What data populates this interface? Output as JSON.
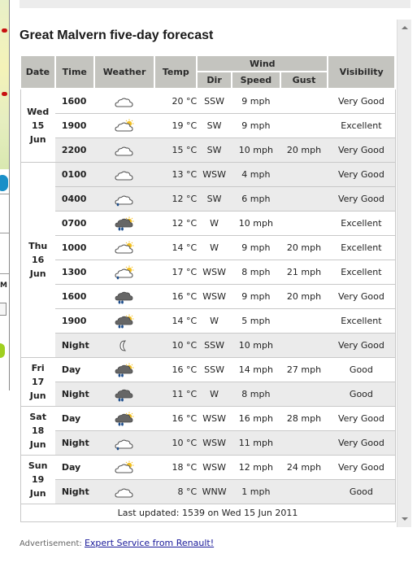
{
  "title": "Great Malvern five-day forecast",
  "columns": {
    "date": "Date",
    "time": "Time",
    "weather": "Weather",
    "temp": "Temp",
    "wind": "Wind",
    "dir": "Dir",
    "speed": "Speed",
    "gust": "Gust",
    "visibility": "Visibility"
  },
  "days": [
    {
      "day": "Wed",
      "date": "15",
      "month": "Jun",
      "rows": [
        {
          "time": "1600",
          "icon": "cloudy",
          "temp": "20 °C",
          "dir": "SSW",
          "speed": "9 mph",
          "gust": "",
          "visibility": "Very Good",
          "shade": false
        },
        {
          "time": "1900",
          "icon": "sunny-intervals",
          "temp": "19 °C",
          "dir": "SW",
          "speed": "9 mph",
          "gust": "",
          "visibility": "Excellent",
          "shade": false
        },
        {
          "time": "2200",
          "icon": "cloudy",
          "temp": "15 °C",
          "dir": "SW",
          "speed": "10 mph",
          "gust": "20 mph",
          "visibility": "Very Good",
          "shade": true
        }
      ]
    },
    {
      "day": "Thu",
      "date": "16",
      "month": "Jun",
      "rows": [
        {
          "time": "0100",
          "icon": "cloudy",
          "temp": "13 °C",
          "dir": "WSW",
          "speed": "4 mph",
          "gust": "",
          "visibility": "Very Good",
          "shade": true
        },
        {
          "time": "0400",
          "icon": "light-rain-shower",
          "temp": "12 °C",
          "dir": "SW",
          "speed": "6 mph",
          "gust": "",
          "visibility": "Very Good",
          "shade": true
        },
        {
          "time": "0700",
          "icon": "heavy-rain-shower-sun",
          "temp": "12 °C",
          "dir": "W",
          "speed": "10 mph",
          "gust": "",
          "visibility": "Excellent",
          "shade": false
        },
        {
          "time": "1000",
          "icon": "sunny-intervals",
          "temp": "14 °C",
          "dir": "W",
          "speed": "9 mph",
          "gust": "20 mph",
          "visibility": "Excellent",
          "shade": false
        },
        {
          "time": "1300",
          "icon": "light-rain-shower-sun",
          "temp": "17 °C",
          "dir": "WSW",
          "speed": "8 mph",
          "gust": "21 mph",
          "visibility": "Excellent",
          "shade": false
        },
        {
          "time": "1600",
          "icon": "heavy-rain",
          "temp": "16 °C",
          "dir": "WSW",
          "speed": "9 mph",
          "gust": "20 mph",
          "visibility": "Very Good",
          "shade": false
        },
        {
          "time": "1900",
          "icon": "heavy-rain-shower-sun",
          "temp": "14 °C",
          "dir": "W",
          "speed": "5 mph",
          "gust": "",
          "visibility": "Excellent",
          "shade": false
        },
        {
          "time": "Night",
          "icon": "clear-night",
          "temp": "10 °C",
          "dir": "SSW",
          "speed": "10 mph",
          "gust": "",
          "visibility": "Very Good",
          "shade": true
        }
      ]
    },
    {
      "day": "Fri",
      "date": "17",
      "month": "Jun",
      "rows": [
        {
          "time": "Day",
          "icon": "heavy-rain-shower-sun",
          "temp": "16 °C",
          "dir": "SSW",
          "speed": "14 mph",
          "gust": "27 mph",
          "visibility": "Good",
          "shade": false
        },
        {
          "time": "Night",
          "icon": "heavy-rain-shower-night",
          "temp": "11 °C",
          "dir": "W",
          "speed": "8 mph",
          "gust": "",
          "visibility": "Good",
          "shade": true
        }
      ]
    },
    {
      "day": "Sat",
      "date": "18",
      "month": "Jun",
      "rows": [
        {
          "time": "Day",
          "icon": "heavy-rain-shower-sun",
          "temp": "16 °C",
          "dir": "WSW",
          "speed": "16 mph",
          "gust": "28 mph",
          "visibility": "Very Good",
          "shade": false
        },
        {
          "time": "Night",
          "icon": "light-rain-shower-night",
          "temp": "10 °C",
          "dir": "WSW",
          "speed": "11 mph",
          "gust": "",
          "visibility": "Very Good",
          "shade": true
        }
      ]
    },
    {
      "day": "Sun",
      "date": "19",
      "month": "Jun",
      "rows": [
        {
          "time": "Day",
          "icon": "sunny-intervals",
          "temp": "18 °C",
          "dir": "WSW",
          "speed": "12 mph",
          "gust": "24 mph",
          "visibility": "Very Good",
          "shade": false
        },
        {
          "time": "Night",
          "icon": "partly-cloudy-night",
          "temp": "8 °C",
          "dir": "WNW",
          "speed": "1 mph",
          "gust": "",
          "visibility": "Good",
          "shade": true
        }
      ]
    }
  ],
  "footer": {
    "last_updated": "Last updated: 1539 on Wed 15 Jun 2011"
  },
  "advertisement": {
    "label": "Advertisement:",
    "link_text": "Expert Service from Renault!"
  },
  "colors": {
    "header_bg": "#c4c4bf",
    "shade_row": "#ebebeb",
    "link": "#1a1a9a",
    "sun": "#f4c020",
    "rain": "#1e4e8c"
  }
}
